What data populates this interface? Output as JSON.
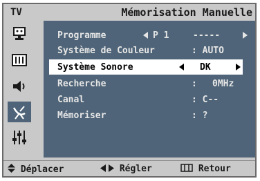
{
  "header": {
    "tv_label": "TV",
    "title": "Mémorisation Manuelle"
  },
  "sidebar": {
    "items": [
      {
        "icon": "tv-input-icon",
        "active": false
      },
      {
        "icon": "picture-icon",
        "active": false
      },
      {
        "icon": "sound-icon",
        "active": false
      },
      {
        "icon": "channel-antenna-icon",
        "active": true
      },
      {
        "icon": "setup-sliders-icon",
        "active": false
      }
    ]
  },
  "menu": {
    "rows": [
      {
        "label": "Programme",
        "value": "P 1",
        "extra": "-----",
        "selected": false
      },
      {
        "label": "Système de Couleur",
        "value": ": AUTO",
        "selected": false
      },
      {
        "label": "Système Sonore",
        "value": "DK",
        "selected": true
      },
      {
        "label": "Recherche",
        "value": ":",
        "extra": "0MHz",
        "selected": false
      },
      {
        "label": "Canal",
        "value": ": C--",
        "selected": false
      },
      {
        "label": "Mémoriser",
        "value": ": ?",
        "selected": false
      }
    ]
  },
  "footer": {
    "move_label": "Déplacer",
    "adjust_label": "Régler",
    "return_label": "Retour"
  },
  "colors": {
    "panel": "#4f6478",
    "frame": "#c9c9c9",
    "highlight": "#ffffff"
  }
}
